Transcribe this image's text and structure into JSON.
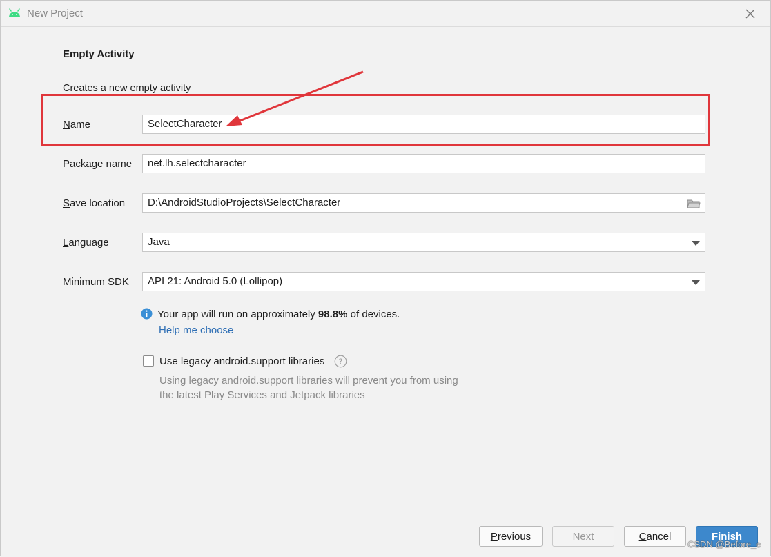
{
  "window": {
    "title": "New Project"
  },
  "activity": {
    "heading": "Empty Activity",
    "description": "Creates a new empty activity"
  },
  "form": {
    "name": {
      "label_first": "N",
      "label_rest": "ame",
      "value": "SelectCharacter"
    },
    "package": {
      "label_first": "P",
      "label_rest": "ackage name",
      "value": "net.lh.selectcharacter"
    },
    "save_location": {
      "label_first": "S",
      "label_rest": "ave location",
      "value": "D:\\AndroidStudioProjects\\SelectCharacter"
    },
    "language": {
      "label_first": "L",
      "label_rest": "anguage",
      "value": "Java"
    },
    "minimum_sdk": {
      "label": "Minimum SDK",
      "value": "API 21: Android 5.0 (Lollipop)"
    }
  },
  "info": {
    "text_before": "Your app will run on approximately ",
    "percentage": "98.8%",
    "text_after": " of devices.",
    "help_link": "Help me choose"
  },
  "legacy": {
    "checkbox_label": "Use legacy android.support libraries",
    "checked": false,
    "hint_line1": "Using legacy android.support libraries will prevent you from using",
    "hint_line2": "the latest Play Services and Jetpack libraries"
  },
  "buttons": {
    "previous_first": "P",
    "previous_rest": "revious",
    "next": "Next",
    "cancel_first": "C",
    "cancel_rest": "ancel",
    "finish": "Finish"
  },
  "watermark": "CSDN @Before_e",
  "colors": {
    "background": "#f2f2f2",
    "highlight": "#e0363b",
    "link": "#2f6fb5",
    "primary_button": "#3d88cc",
    "android_green": "#3ddc84",
    "info_blue": "#3a8fd6"
  },
  "icons": [
    "android-icon",
    "close-icon",
    "folder-icon",
    "dropdown-arrow-icon",
    "info-icon",
    "question-icon"
  ]
}
